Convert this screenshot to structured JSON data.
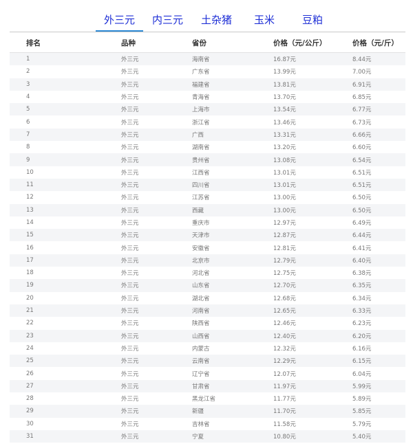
{
  "tabs": [
    {
      "label": "外三元",
      "active": true
    },
    {
      "label": "内三元",
      "active": false
    },
    {
      "label": "土杂猪",
      "active": false
    },
    {
      "label": "玉米",
      "active": false
    },
    {
      "label": "豆粕",
      "active": false
    }
  ],
  "table": {
    "headers": [
      "排名",
      "品种",
      "省份",
      "价格（元/公斤）",
      "价格（元/斤）"
    ],
    "rows": [
      [
        "1",
        "外三元",
        "海南省",
        "16.87元",
        "8.44元"
      ],
      [
        "2",
        "外三元",
        "广东省",
        "13.99元",
        "7.00元"
      ],
      [
        "3",
        "外三元",
        "福建省",
        "13.81元",
        "6.91元"
      ],
      [
        "4",
        "外三元",
        "青海省",
        "13.70元",
        "6.85元"
      ],
      [
        "5",
        "外三元",
        "上海市",
        "13.54元",
        "6.77元"
      ],
      [
        "6",
        "外三元",
        "浙江省",
        "13.46元",
        "6.73元"
      ],
      [
        "7",
        "外三元",
        "广西",
        "13.31元",
        "6.66元"
      ],
      [
        "8",
        "外三元",
        "湖南省",
        "13.20元",
        "6.60元"
      ],
      [
        "9",
        "外三元",
        "贵州省",
        "13.08元",
        "6.54元"
      ],
      [
        "10",
        "外三元",
        "江西省",
        "13.01元",
        "6.51元"
      ],
      [
        "11",
        "外三元",
        "四川省",
        "13.01元",
        "6.51元"
      ],
      [
        "12",
        "外三元",
        "江苏省",
        "13.00元",
        "6.50元"
      ],
      [
        "13",
        "外三元",
        "西藏",
        "13.00元",
        "6.50元"
      ],
      [
        "14",
        "外三元",
        "重庆市",
        "12.97元",
        "6.49元"
      ],
      [
        "15",
        "外三元",
        "天津市",
        "12.87元",
        "6.44元"
      ],
      [
        "16",
        "外三元",
        "安徽省",
        "12.81元",
        "6.41元"
      ],
      [
        "17",
        "外三元",
        "北京市",
        "12.79元",
        "6.40元"
      ],
      [
        "18",
        "外三元",
        "河北省",
        "12.75元",
        "6.38元"
      ],
      [
        "19",
        "外三元",
        "山东省",
        "12.70元",
        "6.35元"
      ],
      [
        "20",
        "外三元",
        "湖北省",
        "12.68元",
        "6.34元"
      ],
      [
        "21",
        "外三元",
        "河南省",
        "12.65元",
        "6.33元"
      ],
      [
        "22",
        "外三元",
        "陕西省",
        "12.46元",
        "6.23元"
      ],
      [
        "23",
        "外三元",
        "山西省",
        "12.40元",
        "6.20元"
      ],
      [
        "24",
        "外三元",
        "内蒙古",
        "12.32元",
        "6.16元"
      ],
      [
        "25",
        "外三元",
        "云南省",
        "12.29元",
        "6.15元"
      ],
      [
        "26",
        "外三元",
        "辽宁省",
        "12.07元",
        "6.04元"
      ],
      [
        "27",
        "外三元",
        "甘肃省",
        "11.97元",
        "5.99元"
      ],
      [
        "28",
        "外三元",
        "黑龙江省",
        "11.77元",
        "5.89元"
      ],
      [
        "29",
        "外三元",
        "新疆",
        "11.70元",
        "5.85元"
      ],
      [
        "30",
        "外三元",
        "吉林省",
        "11.58元",
        "5.79元"
      ],
      [
        "31",
        "外三元",
        "宁夏",
        "10.80元",
        "5.40元"
      ]
    ]
  }
}
